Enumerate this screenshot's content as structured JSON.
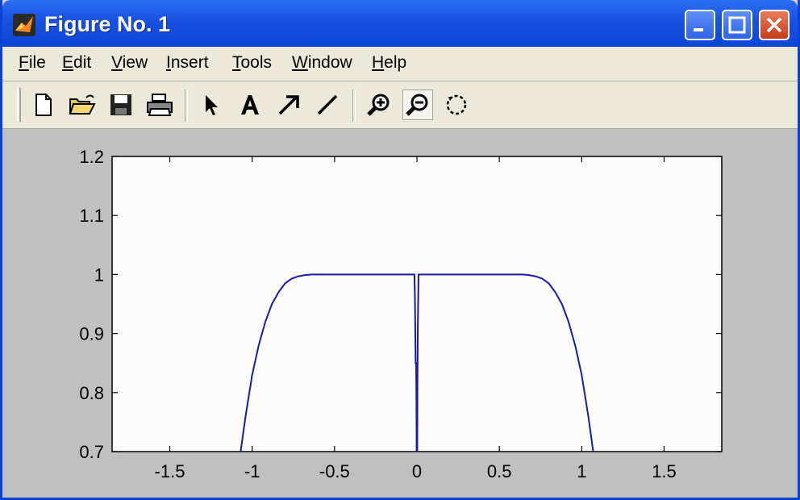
{
  "window": {
    "title": "Figure No. 1",
    "minimize_icon": "minimize-icon",
    "maximize_icon": "maximize-icon",
    "close_icon": "close-icon"
  },
  "menu": {
    "items": [
      "File",
      "Edit",
      "View",
      "Insert",
      "Tools",
      "Window",
      "Help"
    ]
  },
  "toolbar": {
    "tools": [
      "new-file-icon",
      "open-folder-icon",
      "save-icon",
      "print-icon",
      "arrow-select-icon",
      "text-icon",
      "arrow-icon",
      "line-icon",
      "zoom-in-icon",
      "zoom-out-icon",
      "rotate-icon"
    ],
    "pressed": "zoom-out-icon"
  },
  "colors": {
    "title_bar": "#1a53e2",
    "plot_line": "#1a1aa8",
    "axes_bg": "#fcfcfc",
    "figure_bg": "#c0c0c0"
  },
  "chart_data": {
    "type": "line",
    "xlim": [
      -1.85,
      1.85
    ],
    "ylim": [
      0.7,
      1.2
    ],
    "xticks": [
      -1.5,
      -1,
      -0.5,
      0,
      0.5,
      1,
      1.5
    ],
    "xtick_labels": [
      "-1.5",
      "-1",
      "-0.5",
      "0",
      "0.5",
      "1",
      "1.5"
    ],
    "yticks": [
      0.7,
      0.8,
      0.9,
      1.0,
      1.1,
      1.2
    ],
    "ytick_labels": [
      "0.7",
      "0.8",
      "0.9",
      "1",
      "1.1",
      "1.2"
    ],
    "grid": false,
    "series": [
      {
        "x": [
          -1.07,
          -1.04,
          -1.0,
          -0.96,
          -0.92,
          -0.88,
          -0.84,
          -0.8,
          -0.76,
          -0.72,
          -0.68,
          -0.64,
          -0.5,
          -0.3,
          -0.1,
          -0.02,
          -0.015,
          -0.012,
          -0.01,
          -0.008,
          -0.005,
          -0.003,
          -0.002
        ],
        "y": [
          0.7,
          0.76,
          0.83,
          0.88,
          0.92,
          0.95,
          0.97,
          0.985,
          0.993,
          0.997,
          0.999,
          1.0,
          1.0,
          1.0,
          1.0,
          1.0,
          1.0,
          0.96,
          0.9,
          0.85,
          0.85,
          0.78,
          0.7
        ]
      },
      {
        "x": [
          0.002,
          0.003,
          0.005,
          0.01,
          0.02,
          0.1,
          0.3,
          0.5,
          0.64,
          0.68,
          0.72,
          0.76,
          0.8,
          0.84,
          0.88,
          0.92,
          0.96,
          1.0,
          1.04,
          1.07
        ],
        "y": [
          0.7,
          0.8,
          0.9,
          1.0,
          1.0,
          1.0,
          1.0,
          1.0,
          1.0,
          0.999,
          0.997,
          0.993,
          0.985,
          0.97,
          0.95,
          0.92,
          0.88,
          0.83,
          0.76,
          0.7
        ]
      }
    ]
  }
}
